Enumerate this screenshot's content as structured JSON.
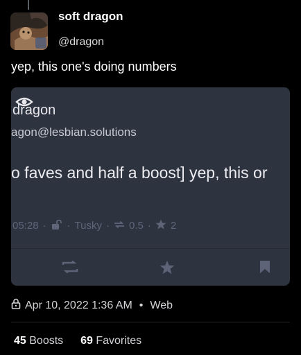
{
  "post": {
    "display_name": "soft dragon",
    "handle": "@dragon",
    "text": "yep, this one's doing numbers"
  },
  "quoted": {
    "name": "dragon",
    "acct": "agon@lesbian.solutions",
    "content": "o faves and half a boost] yep, this or",
    "time": "05:28",
    "client": "Tusky",
    "boosts": "0.5",
    "favs": "2",
    "sep": "·"
  },
  "footer": {
    "date": "Apr 10, 2022 1:36 AM",
    "dot": "•",
    "client": "Web"
  },
  "stats": {
    "boosts_count": "45",
    "boosts_label": "Boosts",
    "favorites_count": "69",
    "favorites_label": "Favorites"
  },
  "icons": [
    "avatar-image",
    "eye-icon",
    "lock-open-icon",
    "boost-icon",
    "star-icon",
    "bookmark-icon",
    "lock-icon"
  ]
}
